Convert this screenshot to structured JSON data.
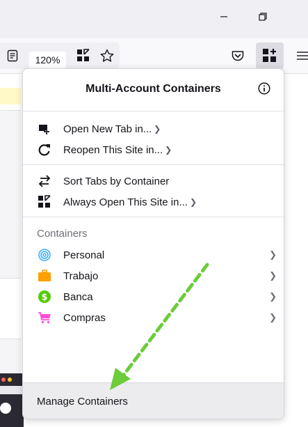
{
  "browser": {
    "zoom_level": "120%",
    "window_controls": [
      "minimize-icon",
      "restore-icon"
    ]
  },
  "panel": {
    "title": "Multi-Account Containers",
    "actions": [
      {
        "label": "Open New Tab in...",
        "icon": "new-tab-icon"
      },
      {
        "label": "Reopen This Site in...",
        "icon": "reopen-icon"
      },
      {
        "label": "Sort Tabs by Container",
        "icon": "sort-icon"
      },
      {
        "label": "Always Open This Site in...",
        "icon": "always-open-icon"
      }
    ],
    "containers_heading": "Containers",
    "containers": [
      {
        "name": "Personal",
        "icon": "fingerprint-icon",
        "color": "#37adff"
      },
      {
        "name": "Trabajo",
        "icon": "briefcase-icon",
        "color": "#ff9f00"
      },
      {
        "name": "Banca",
        "icon": "dollar-icon",
        "color": "#51cd00"
      },
      {
        "name": "Compras",
        "icon": "cart-icon",
        "color": "#ff4bda"
      }
    ],
    "footer_label": "Manage Containers"
  },
  "annotation": {
    "arrow_color": "#6ccc3a"
  }
}
